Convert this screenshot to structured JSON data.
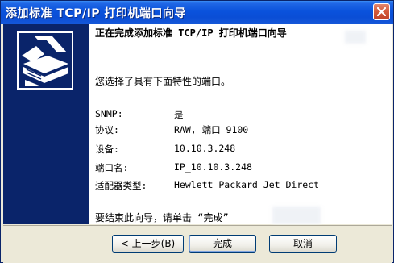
{
  "window": {
    "title": "添加标准 TCP/IP 打印机端口向导"
  },
  "sidebar": {
    "icon": "printer-wizard-icon"
  },
  "main": {
    "heading": "正在完成添加标准 TCP/IP 打印机端口向导",
    "intro": "您选择了具有下面特性的端口。",
    "properties": [
      {
        "label": "SNMP:",
        "value": "是"
      },
      {
        "label": "协议:",
        "value": "RAW, 端口 9100"
      },
      {
        "label": "设备:",
        "value": "10.10.3.248"
      },
      {
        "label": "端口名:",
        "value": "IP_10.10.3.248"
      },
      {
        "label": "适配器类型:",
        "value": "Hewlett Packard Jet Direct"
      }
    ],
    "finish_note": "要结束此向导，请单击 “完成”"
  },
  "footer": {
    "back_label": "< 上一步(B)",
    "finish_label": "完成",
    "cancel_label": "取消"
  },
  "colors": {
    "titlebar": "#0a52dc",
    "sidebar": "#0a246a",
    "dialog_bg": "#ece9d8",
    "close_button": "#d35a3a"
  }
}
